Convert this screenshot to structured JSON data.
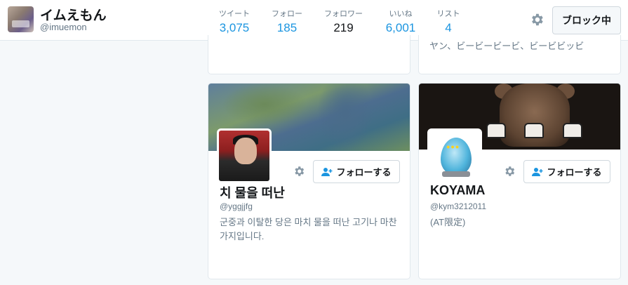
{
  "profile": {
    "name": "イムえもん",
    "handle": "@imuemon"
  },
  "stats": [
    {
      "label": "ツイート",
      "value": "3,075"
    },
    {
      "label": "フォロー",
      "value": "185"
    },
    {
      "label": "フォロワー",
      "value": "219",
      "active": true
    },
    {
      "label": "いいね",
      "value": "6,001"
    },
    {
      "label": "リスト",
      "value": "4"
    }
  ],
  "actions": {
    "block_label": "ブロック中"
  },
  "previous_cards": {
    "right_bio": "ヤン、ビービービービ、ビービビッビ"
  },
  "cards": [
    {
      "name": "치 물을 떠난",
      "handle": "@yggjjfg",
      "bio": "군중과 이탈한 당은 마치 물을 떠난 고기나 마찬가지입니다.",
      "follow_label": "フォローする"
    },
    {
      "name": "KOYAMA",
      "handle": "@kym3212011",
      "bio": "(AT限定)",
      "follow_label": "フォローする"
    }
  ],
  "colors": {
    "accent": "#1b95e0",
    "muted_text": "#657786",
    "background": "#f5f8fa"
  },
  "icons": {
    "settings": "gear-icon",
    "follow": "add-user-icon"
  }
}
